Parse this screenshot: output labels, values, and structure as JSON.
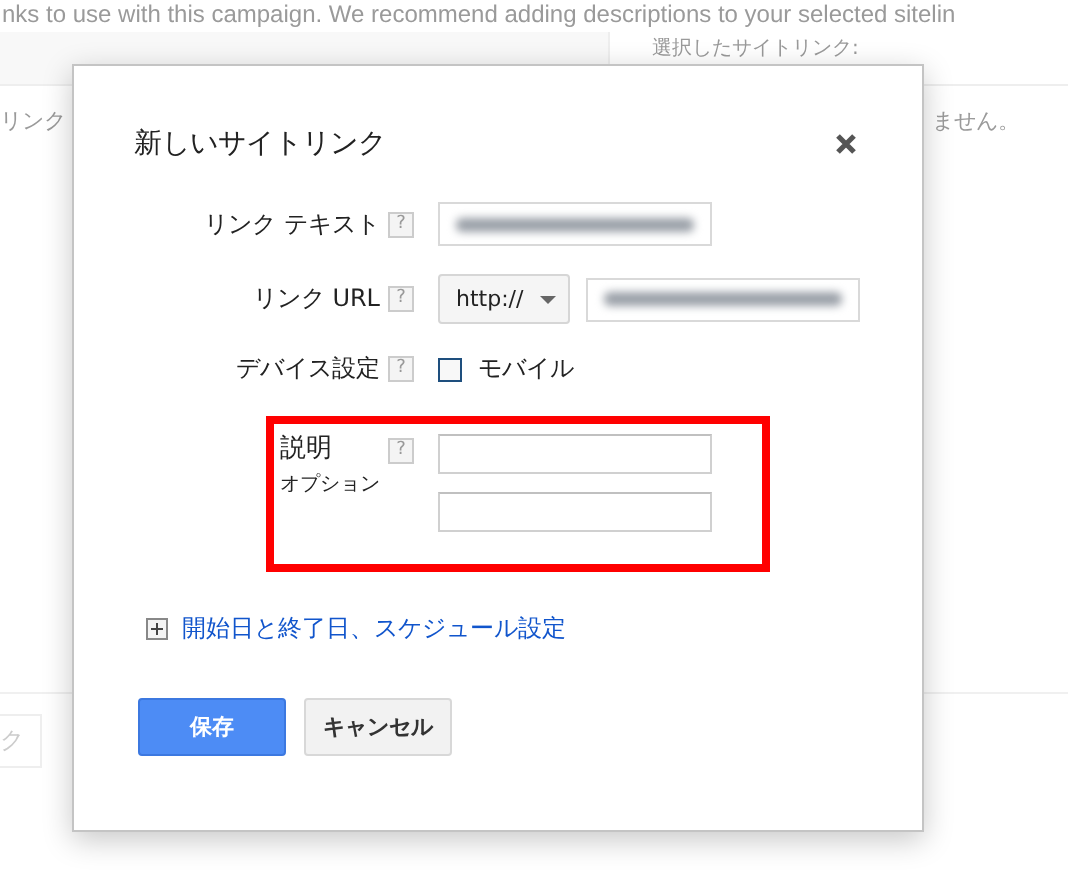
{
  "background": {
    "intro_text": "nks to use with this campaign. We recommend adding descriptions to your selected sitelin",
    "selected_label": "選択したサイトリンク:",
    "left_text": "リンク",
    "right_text": "ません。",
    "button_label": "ク"
  },
  "dialog": {
    "title": "新しいサイトリンク",
    "fields": [
      {
        "kind": "text",
        "label": "リンク テキスト",
        "help": "?",
        "value_redacted": true
      },
      {
        "kind": "url",
        "label": "リンク URL",
        "help": "?",
        "protocol": "http://",
        "value_redacted": true
      },
      {
        "kind": "checkbox",
        "label": "デバイス設定",
        "help": "?",
        "option": "モバイル",
        "checked": false
      },
      {
        "kind": "description",
        "label": "説明",
        "help": "?",
        "sublabel": "オプション",
        "highlighted": true
      }
    ],
    "schedule_link": {
      "text": "開始日と終了日、スケジュール設定",
      "expanded": false
    },
    "buttons": [
      {
        "kind": "primary",
        "label": "保存"
      },
      {
        "kind": "secondary",
        "label": "キャンセル"
      }
    ]
  }
}
